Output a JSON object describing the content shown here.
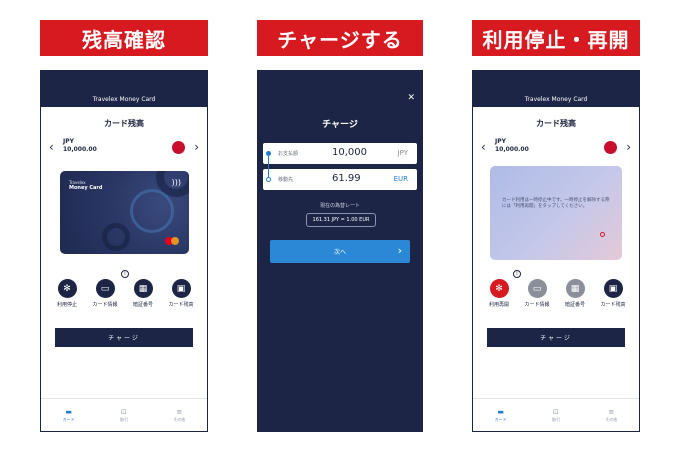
{
  "colors": {
    "accent": "#d71920",
    "navy": "#1c2545",
    "blue": "#1f7bd1"
  },
  "banners": [
    "残高確認",
    "チャージする",
    "利用停止・再開"
  ],
  "app_title": "Travelex Money Card",
  "screen_title": "カード残高",
  "balance": {
    "currency": "JPY",
    "amount": "10,000.00",
    "flag": "japan-flag-icon"
  },
  "card": {
    "brand_small": "Travelex",
    "brand_name": "Money Card"
  },
  "actions1": [
    {
      "label": "利用停止",
      "icon": "snowflake-icon",
      "glyph": "✻"
    },
    {
      "label": "カード情報",
      "icon": "card-icon",
      "glyph": "▭"
    },
    {
      "label": "暗証番号",
      "icon": "keypad-icon",
      "glyph": "▦"
    },
    {
      "label": "カード残高",
      "icon": "wallet-icon",
      "glyph": "▣"
    }
  ],
  "actions3": [
    {
      "label": "利用再開",
      "icon": "snowflake-icon",
      "glyph": "✻"
    },
    {
      "label": "カード情報",
      "icon": "card-icon",
      "glyph": "▭"
    },
    {
      "label": "暗証番号",
      "icon": "keypad-icon",
      "glyph": "▦"
    },
    {
      "label": "カード残高",
      "icon": "wallet-icon",
      "glyph": "▣"
    }
  ],
  "charge_button": "チャージ",
  "tabs": [
    {
      "label": "カード",
      "icon": "card-tab-icon",
      "glyph": "▬"
    },
    {
      "label": "取引",
      "icon": "money-tab-icon",
      "glyph": "⊡"
    },
    {
      "label": "その他",
      "icon": "menu-tab-icon",
      "glyph": "≡"
    }
  ],
  "frozen_notice": "カード利用は一時停止中です。一時停止を解除する際には「利用再開」をタップしてください。",
  "charge": {
    "title": "チャージ",
    "pay_label": "お支払額",
    "pay_value": "10,000",
    "pay_currency": "JPY",
    "to_label": "移動先",
    "to_value": "61.99",
    "to_currency": "EUR",
    "rate_label": "現在の為替レート",
    "rate_value": "161.31 JPY = 1.00 EUR",
    "next": "次へ"
  }
}
